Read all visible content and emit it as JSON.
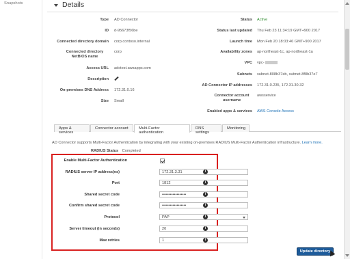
{
  "sidebar": {
    "item": "Snapshots"
  },
  "details": {
    "title": "Details"
  },
  "left_fields": [
    {
      "label": "Type",
      "value": "AD Connector"
    },
    {
      "label": "ID",
      "value": "d-95673f56be"
    },
    {
      "label": "Connected directory domain",
      "value": "corp.contoso.internal"
    },
    {
      "label": "Connected directory NetBIOS name",
      "value": "corp"
    },
    {
      "label": "Access URL",
      "value": "adctest.awsapps.com"
    },
    {
      "label": "Description",
      "value": ""
    },
    {
      "label": "On-premises DNS Address",
      "value": "172.31.0.16"
    },
    {
      "label": "Size",
      "value": "Small"
    }
  ],
  "right_fields": [
    {
      "label": "Status",
      "value": "Active"
    },
    {
      "label": "Status last updated",
      "value": "Thu Feb 23 11:34:19 GMT+900 2017"
    },
    {
      "label": "Launch time",
      "value": "Mon Feb 20 18:03:46 GMT+900 2017"
    },
    {
      "label": "Availability zones",
      "value": "ap-northeast-1c, ap-northeast-1a"
    },
    {
      "label": "VPC",
      "value": "vpc-"
    },
    {
      "label": "Subnets",
      "value": "subnet-808b37eb, subnet-8f8b37e7"
    },
    {
      "label": "AD Connector IP addresses",
      "value": "172.31.0.235, 172.31.30.32"
    },
    {
      "label": "Connector account username",
      "value": "awsservice"
    },
    {
      "label": "Enabled apps & services",
      "value": "AWS Console Access"
    }
  ],
  "tabs": [
    "Apps & services",
    "Connector account",
    "Multi-Factor authentication",
    "DNS settings",
    "Monitoring"
  ],
  "mfa": {
    "description": "AD Connector supports Multi-Factor Authentication by integrating with your existing on-premises RADIUS Multi-Factor Authentication infrastructure.",
    "learn_more": "Learn more.",
    "radius_status_label": "RADIUS Status",
    "radius_status_value": "Completed",
    "enable_label": "Enable Multi-Factor Authentication",
    "fields": [
      {
        "label": "RADIUS server IP address(es)",
        "value": "172.31.3.31"
      },
      {
        "label": "Port",
        "value": "1812"
      },
      {
        "label": "Shared secret code",
        "value": "••••••••••••••••••"
      },
      {
        "label": "Confirm shared secret code",
        "value": "••••••••••••••••••"
      },
      {
        "label": "Protocol",
        "value": "PAP"
      },
      {
        "label": "Server timeout (in seconds)",
        "value": "20"
      },
      {
        "label": "Max retries",
        "value": "1"
      }
    ]
  },
  "update_button": "Update directory",
  "info_glyph": "i",
  "colors": {
    "accent_red": "#d9201f",
    "active_green": "#2e8b2e",
    "link_blue": "#1a6fb5",
    "button_blue": "#1d5b9a"
  }
}
